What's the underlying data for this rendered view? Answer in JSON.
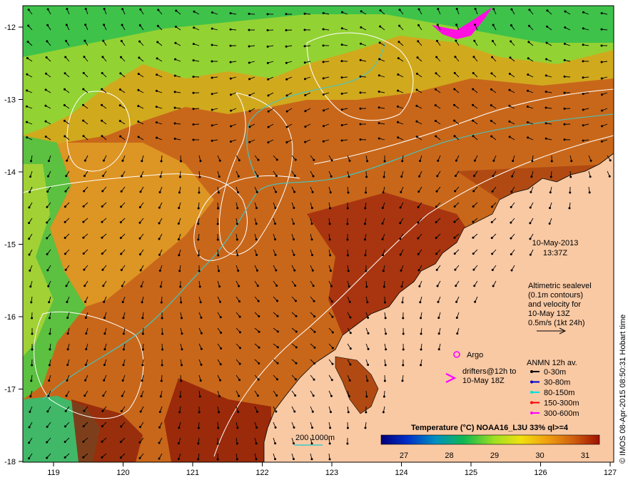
{
  "map": {
    "lon_ticks": [
      "119",
      "120",
      "121",
      "122",
      "123",
      "124",
      "125",
      "126",
      "127"
    ],
    "lat_ticks": [
      "-12",
      "-13",
      "-14",
      "-15",
      "-16",
      "-17",
      "-18"
    ],
    "date": "10-May-2013",
    "time": "13:37Z",
    "altimetry_lines": [
      "Altimetric sealevel",
      "(0.1m contours)",
      "and velocity for",
      "10-May 13Z",
      "0.5m/s (1kt 24h)"
    ],
    "argo_label": "Argo",
    "drifters_lines": [
      "drifters@12h to",
      "10-May 18Z"
    ],
    "anmn_title": "ANMN 12h av.",
    "anmn_legend": [
      {
        "label": "0-30m",
        "color": "#000000"
      },
      {
        "label": "30-80m",
        "color": "#0000cc"
      },
      {
        "label": "80-150m",
        "color": "#00e0e0"
      },
      {
        "label": "150-300m",
        "color": "#ff0000"
      },
      {
        "label": "300-600m",
        "color": "#ff00ff"
      }
    ],
    "bathy_label": "200  1000m",
    "colorbar_title": "Temperature (°C) NOAA16_L3U 33% ql>=4",
    "colorbar_ticks": [
      "27",
      "28",
      "29",
      "30",
      "31"
    ],
    "credit": "© IMOS 08-Apr-2015 08:50:31 Hobart time",
    "colors": {
      "land": "#f9c9a4",
      "sst_warm": "#c8671a",
      "sst_hot": "#9a2a0a",
      "sst_mid": "#e4a428",
      "sst_cool": "#d8e020",
      "sst_green": "#3ec24a",
      "contour": "#ffffff",
      "bathy": "#40c8c8",
      "drifter": "#ff00ff"
    }
  }
}
